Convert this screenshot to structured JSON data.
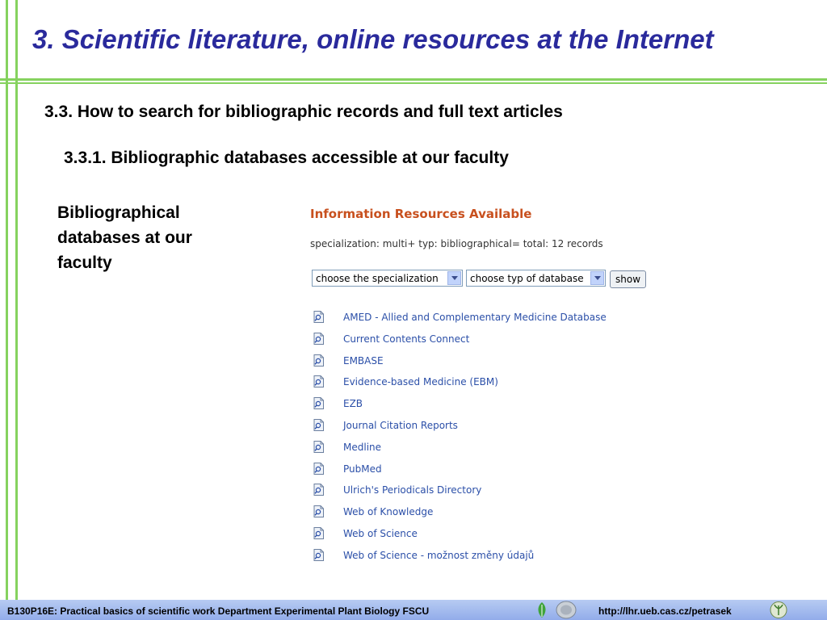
{
  "slide": {
    "title": "3. Scientific literature, online resources at the Internet",
    "section": "3.3. How to search for bibliographic records and full text articles",
    "subsection": "3.3.1. Bibliographic databases accessible at our faculty",
    "sidenote": "Bibliographical databases at our faculty"
  },
  "panel": {
    "title": "Information Resources Available",
    "summary": "specialization: multi+ typ: bibliographical= total: 12 records",
    "specialization_select": "choose the specialization",
    "type_select": "choose typ of database",
    "show_label": "show",
    "databases": [
      "AMED - Allied and Complementary Medicine Database",
      "Current Contents Connect",
      "EMBASE",
      "Evidence-based Medicine (EBM)",
      "EZB",
      "Journal Citation Reports",
      "Medline",
      "PubMed",
      "Ulrich's Periodicals Directory",
      "Web of Knowledge",
      "Web of Science",
      "Web of Science - možnost změny údajů"
    ]
  },
  "footer": {
    "left": "B130P16E: Practical basics of scientific work   Department  Experimental Plant Biology  FSCU",
    "url": "http://lhr.ueb.cas.cz/petrasek"
  },
  "colors": {
    "accent_green": "#86d25f",
    "title_blue": "#2a2a9c",
    "panel_title": "#c8501e",
    "link": "#2b4fa8",
    "footer_bar": "#a9c0ef"
  }
}
